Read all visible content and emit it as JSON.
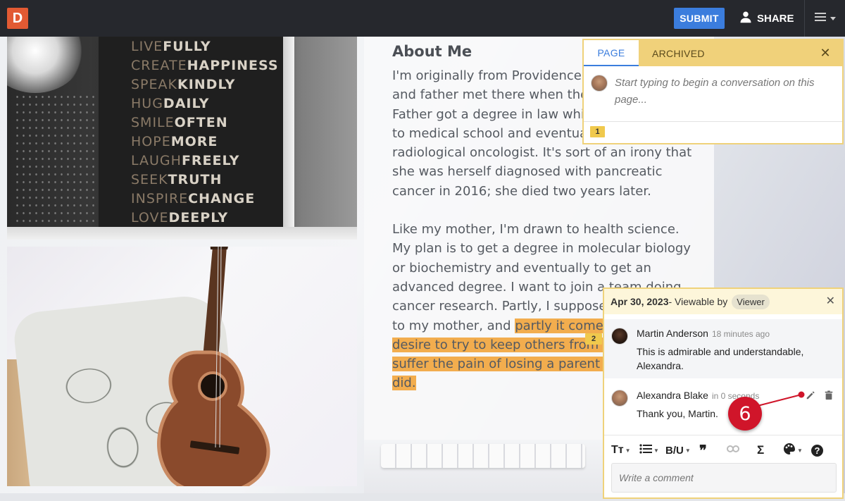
{
  "app": {
    "logo_letter": "D",
    "submit_label": "SUBMIT",
    "share_label": "SHARE"
  },
  "book_lines": [
    [
      "LIVE",
      "FULLY"
    ],
    [
      "CREATE",
      "HAPPINESS"
    ],
    [
      "SPEAK",
      "KINDLY"
    ],
    [
      "HUG",
      "DAILY"
    ],
    [
      "SMILE",
      "OFTEN"
    ],
    [
      "HOPE",
      "MORE"
    ],
    [
      "LAUGH",
      "FREELY"
    ],
    [
      "SEEK",
      "TRUTH"
    ],
    [
      "INSPIRE",
      "CHANGE"
    ],
    [
      "LOVE",
      "DEEPLY"
    ]
  ],
  "article": {
    "title": "About Me",
    "p1": "I'm originally from Providence, R.I. My mother and father met there when they were students. Father got a degree in law while mother went to medical school and eventually became a radiological oncologist. It's sort of an irony that she was herself diagnosed with pancreatic cancer in 2016; she died two years later.",
    "p2_plain": "Like my mother, I'm drawn to health science. My plan is to get a degree in molecular biology or biochemistry and eventually to get an advanced degree. I want to join a team doing cancer research. Partly, I suppose, it's a tribute to my mother, and ",
    "p2_highlight": "partly it comes from a desire to try to keep others from having to suffer the pain of losing a parent to cancer as I did.",
    "marker_2": "2"
  },
  "page_panel": {
    "tab_page": "PAGE",
    "tab_archived": "ARCHIVED",
    "close_glyph": "✕",
    "compose_placeholder": "Start typing to begin a conversation on this page...",
    "marker_1": "1"
  },
  "thread": {
    "date": "Apr 30, 2023",
    "viewable_text": " - Viewable by",
    "viewer_badge": "Viewer",
    "close_glyph": "✕",
    "comments": [
      {
        "author": "Martin Anderson",
        "time": "18 minutes ago",
        "text": "This is admirable and understandable, Alexandra."
      },
      {
        "author": "Alexandra Blake",
        "time": "in 0 seconds",
        "text": "Thank you, Martin."
      }
    ],
    "toolbar": {
      "text_style": "Tт",
      "bold_underline": "B/U",
      "quote": "❞",
      "sigma": "Σ",
      "help": "?"
    },
    "input_placeholder": "Write a comment"
  },
  "callout": {
    "number": "6",
    "color": "#d0152a"
  },
  "colors": {
    "topbar": "#26282d",
    "accent_blue": "#3b7ddd",
    "logo": "#e25a33",
    "highlight": "#f2ad4e",
    "panel_border": "#efd27a"
  },
  "icons": {
    "share": "person-icon",
    "menu": "hamburger-menu-icon",
    "edit": "pencil-icon",
    "delete": "trash-icon",
    "list": "bullet-list-icon",
    "link": "link-icon",
    "palette": "palette-icon"
  }
}
